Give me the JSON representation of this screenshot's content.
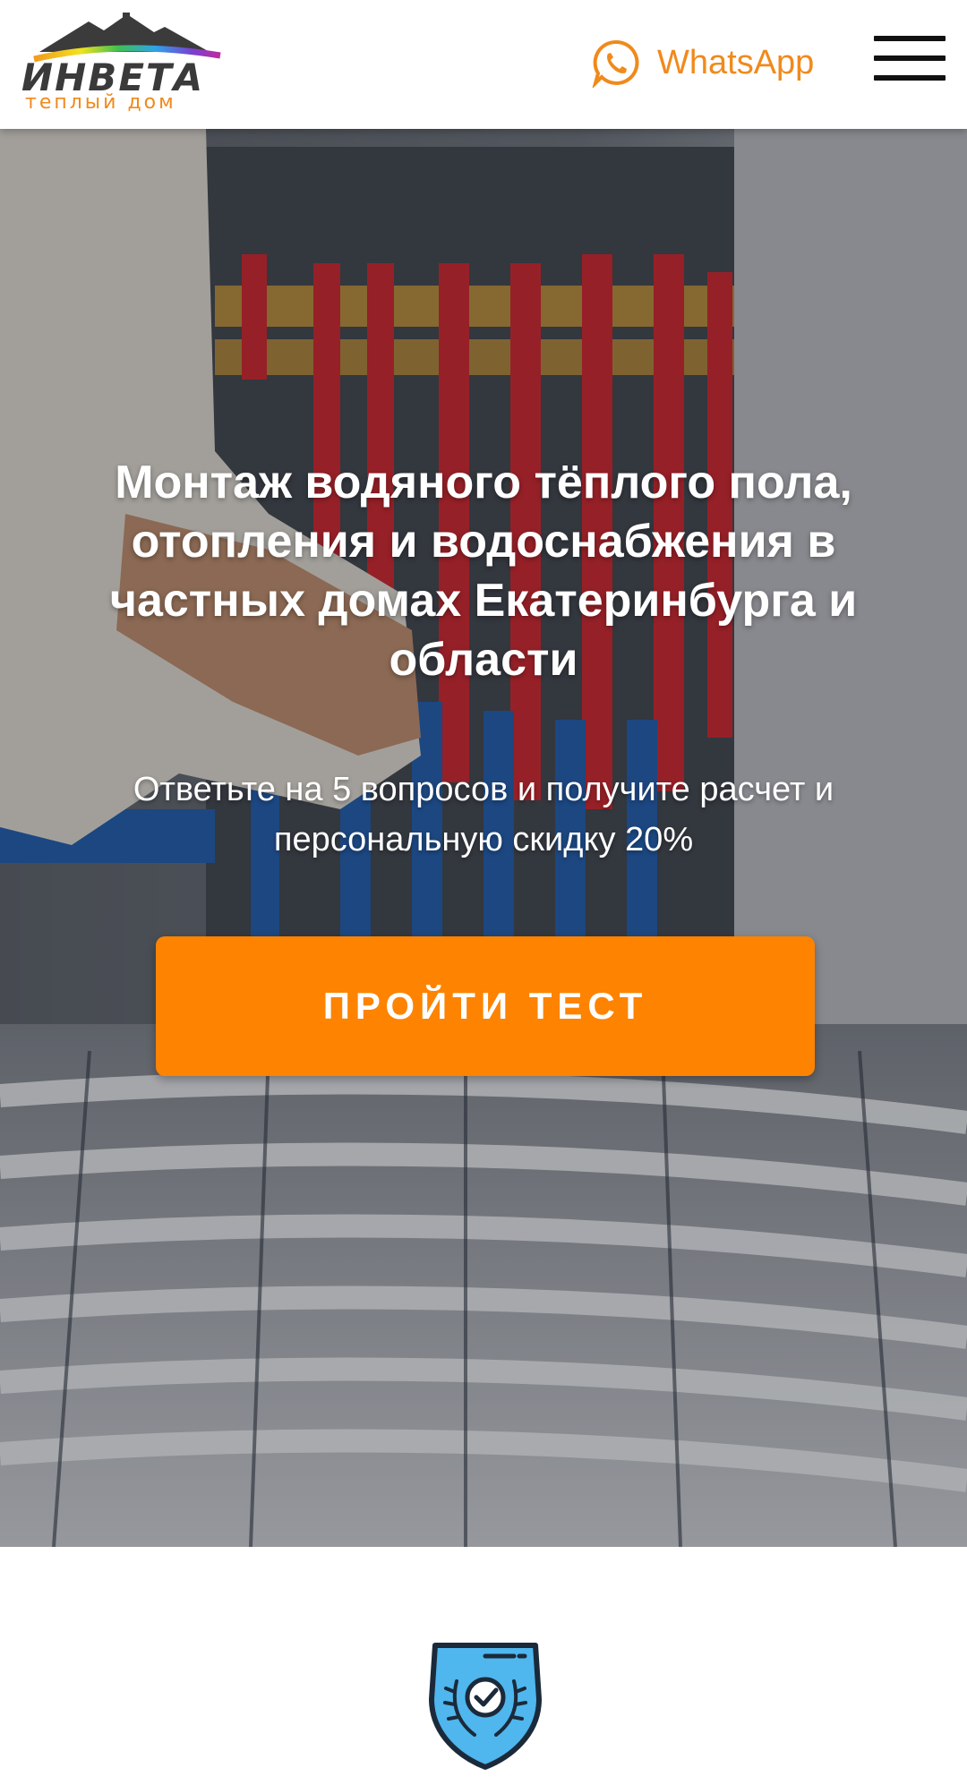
{
  "header": {
    "logo_main": "ИНВЕТА",
    "logo_sub": "теплый дом",
    "whatsapp_label": "WhatsApp",
    "whatsapp_icon": "whatsapp-icon",
    "menu_icon": "hamburger-menu-icon"
  },
  "hero": {
    "title": "Монтаж водяного тёплого пола, отопления и водоснабжения в частных домах Екатеринбурга и области",
    "subtitle": "Ответьте на 5 вопросов и получите расчет и персональную скидку 20%",
    "cta_label": "ПРОЙТИ ТЕСТ",
    "background_image": "photo of floor heating manifold with red and blue pipes"
  },
  "features": {
    "badge_icon": "shield-check-icon"
  },
  "colors": {
    "accent": "#fe8300",
    "brand_orange": "#f08a1c",
    "badge_blue": "#4fb6ee",
    "text_dark": "#111111"
  }
}
